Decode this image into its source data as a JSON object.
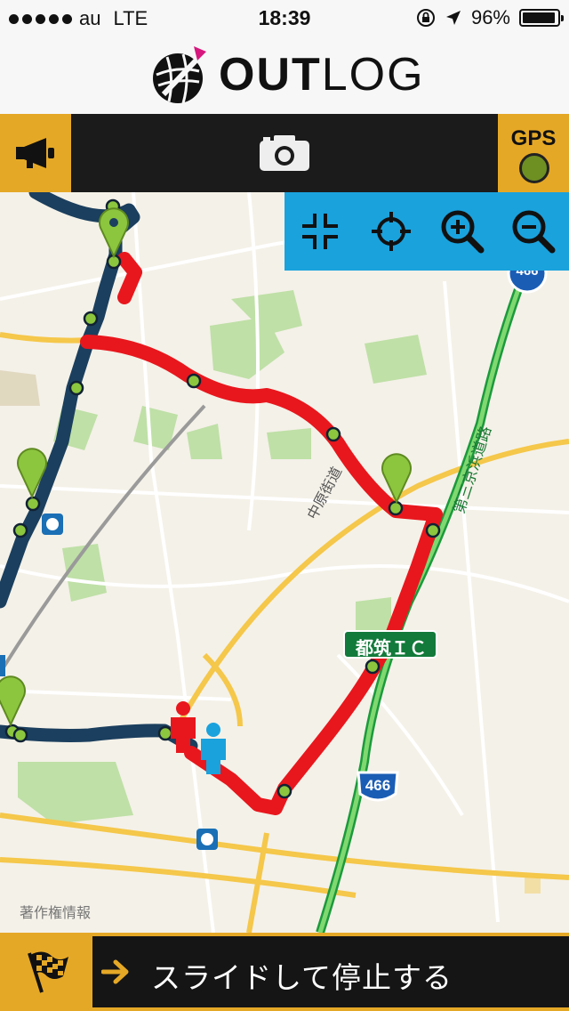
{
  "status_bar": {
    "carrier": "au",
    "network": "LTE",
    "time": "18:39",
    "battery_text": "96%",
    "battery_level": 0.96,
    "icons": [
      "signal-dots-icon",
      "orientation-lock-icon",
      "location-arrow-icon",
      "battery-icon"
    ]
  },
  "header": {
    "brand_bold": "OUT",
    "brand_light": "LOG",
    "logo_icon": "globe-logo-icon"
  },
  "toolbar": {
    "left_icon": "megaphone-icon",
    "center_icon": "camera-icon",
    "gps_label": "GPS",
    "gps_status_color": "#6e8f22",
    "accent_color": "#e5a826"
  },
  "map_controls": {
    "buttons": [
      "collapse-icon",
      "locate-icon",
      "zoom-in-icon",
      "zoom-out-icon"
    ],
    "background_color": "#1aa2dd"
  },
  "map": {
    "road_label_1": "中原街道",
    "road_label_2": "第三京浜道路",
    "ic_sign": "都筑ＩＣ",
    "route_shield_1": "466",
    "route_shield_2": "466",
    "copyright": "著作権情報",
    "route_colors": {
      "current": "#e8171d",
      "past": "#1b3f5e"
    }
  },
  "bottom_bar": {
    "flag_icon": "checkered-flag-icon",
    "arrow_icon": "right-arrow-icon",
    "slider_text": "スライドして停止する"
  }
}
